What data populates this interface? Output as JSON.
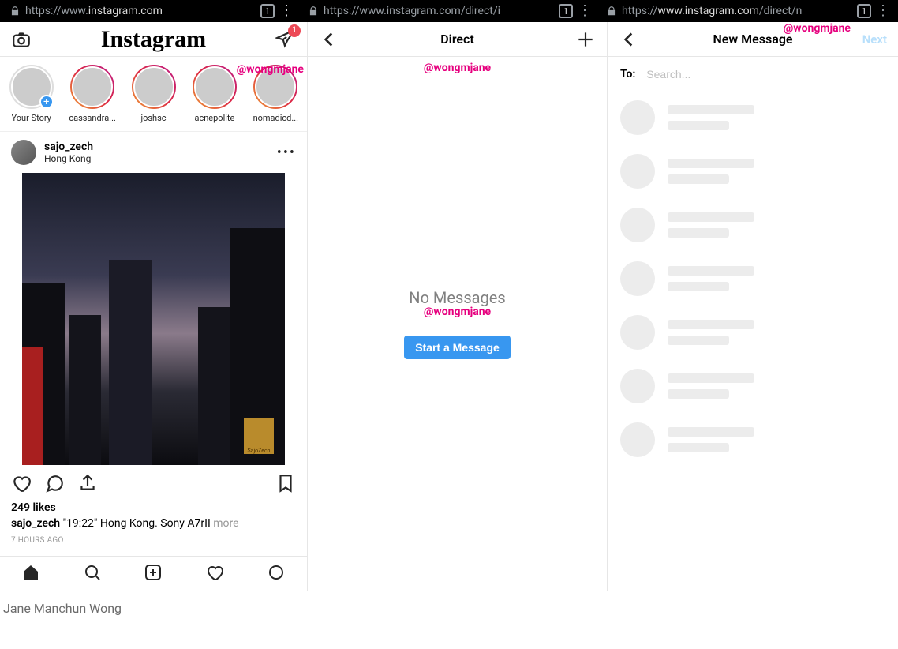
{
  "browser": {
    "tabs": [
      {
        "url": "https://www.instagram.com",
        "count": "1"
      },
      {
        "url": "https://www.instagram.com/direct/i",
        "count": "1"
      },
      {
        "url": "https://www.instagram.com/direct/n",
        "count": "1"
      }
    ]
  },
  "watermark": "@wongmjane",
  "feed": {
    "brand": "Instagram",
    "dm_badge": "1",
    "stories": [
      {
        "label": "Your Story",
        "self": true
      },
      {
        "label": "cassandra..."
      },
      {
        "label": "joshsc"
      },
      {
        "label": "acnepolite"
      },
      {
        "label": "nomadicd..."
      }
    ],
    "post": {
      "username": "sajo_zech",
      "location": "Hong Kong",
      "likes": "249 likes",
      "caption_user": "sajo_zech",
      "caption_text": "\"19:22\" Hong Kong. Sony A7rII",
      "more": "more",
      "timestamp": "7 HOURS AGO",
      "signature": "SajoZech"
    }
  },
  "direct": {
    "title": "Direct",
    "empty_title": "No Messages",
    "start_button": "Start a Message"
  },
  "newmsg": {
    "title": "New Message",
    "next": "Next",
    "to_label": "To:",
    "search_placeholder": "Search...",
    "suggestion_count": 7
  },
  "credit": "Jane Manchun Wong"
}
